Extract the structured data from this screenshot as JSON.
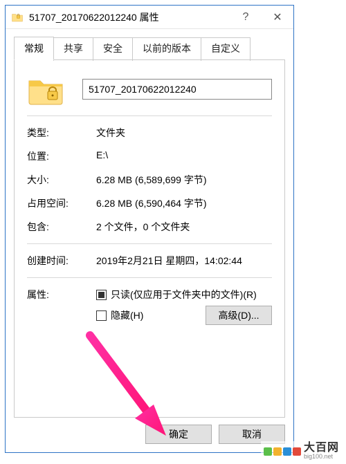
{
  "window": {
    "title": "51707_20170622012240 属性",
    "close_glyph": "✕",
    "help_glyph": "?"
  },
  "tabs": {
    "general": "常规",
    "share": "共享",
    "security": "安全",
    "prevver": "以前的版本",
    "custom": "自定义"
  },
  "general": {
    "name_value": "51707_20170622012240",
    "labels": {
      "type": "类型:",
      "location": "位置:",
      "size": "大小:",
      "sizeondisk": "占用空间:",
      "contains": "包含:",
      "created": "创建时间:",
      "attributes": "属性:"
    },
    "values": {
      "type": "文件夹",
      "location": "E:\\",
      "size": "6.28 MB (6,589,699 字节)",
      "sizeondisk": "6.28 MB (6,590,464 字节)",
      "contains": "2 个文件，0 个文件夹",
      "created": "2019年2月21日 星期四，14:02:44"
    },
    "readonly_label": "只读(仅应用于文件夹中的文件)(R)",
    "hidden_label": "隐藏(H)",
    "advanced_label": "高级(D)..."
  },
  "buttons": {
    "ok": "确定",
    "cancel": "取消"
  },
  "watermark": {
    "main": "大百网",
    "sub": "big100.net",
    "colors": [
      "#5bbf4a",
      "#f2b22e",
      "#2a8fd8",
      "#e24a3b"
    ]
  }
}
